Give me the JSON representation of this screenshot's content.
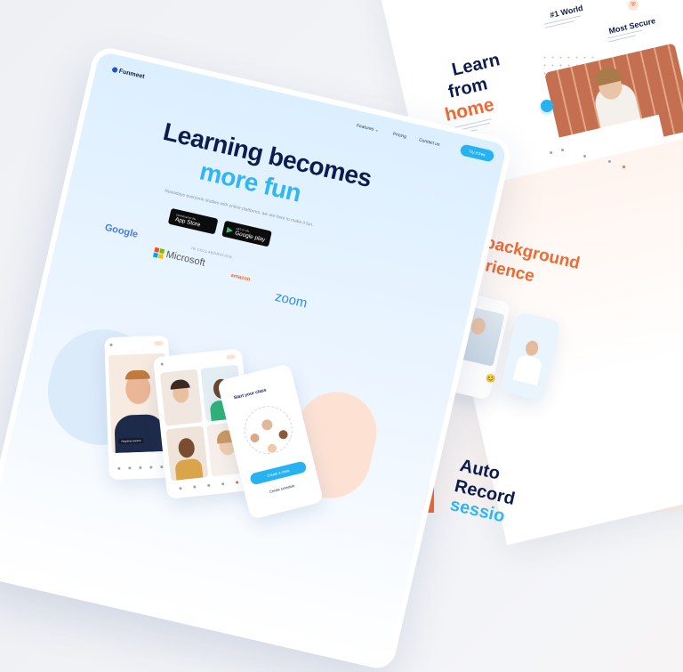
{
  "brand": "Funmeet",
  "nav": {
    "features": "Features",
    "features_caret": "⌄",
    "pricing": "Pricing",
    "contact": "Contact us",
    "cta": "Try it free"
  },
  "hero": {
    "line1": "Learning becomes",
    "line2": "more fun",
    "subtitle": "Nowadays everyone studies with online platforms, we are here to make it fun."
  },
  "stores": {
    "app_store_small": "Download on the",
    "app_store_big": "App Store",
    "google_small": "GET IT ON",
    "google_big": "Google play"
  },
  "collab": {
    "label": "IN COLLABORATION",
    "partners": [
      "Google",
      "Microsoft",
      "amazon",
      "zoom"
    ]
  },
  "phones": {
    "start_class": "Start your class",
    "screen_label": "Ongoing session",
    "create_btn": "Create a class",
    "join_btn": "Create schedule"
  },
  "features": {
    "world": "#1 World",
    "secure": "Most Secure"
  },
  "learn": {
    "line1": "Learn",
    "line2": "from",
    "line3": "home"
  },
  "background": {
    "line1": "background",
    "line2": "erience"
  },
  "record": {
    "line1": "Auto",
    "line2": "Record",
    "line3": "sessio"
  },
  "colors": {
    "navy": "#0d1c4f",
    "sky": "#2fb6f3",
    "orange": "#f06a32"
  }
}
